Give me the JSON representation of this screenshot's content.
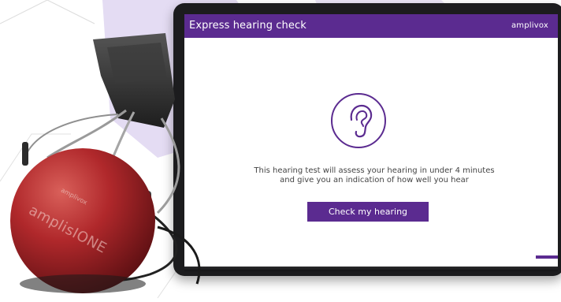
{
  "app": {
    "title": "Express hearing check",
    "brand": "amplivox"
  },
  "main": {
    "icon": "ear-icon",
    "description_line1": "This hearing test will assess your hearing in under 4 minutes",
    "description_line2": "and give you an indication of how well you hear",
    "cta_label": "Check my hearing"
  },
  "product": {
    "headphone_brand": "amplivox",
    "headphone_model": "amplisIONE"
  },
  "colors": {
    "accent": "#5b2b90",
    "background_shape": "#d9d1ee",
    "headphone_cup": "#b0282b"
  }
}
